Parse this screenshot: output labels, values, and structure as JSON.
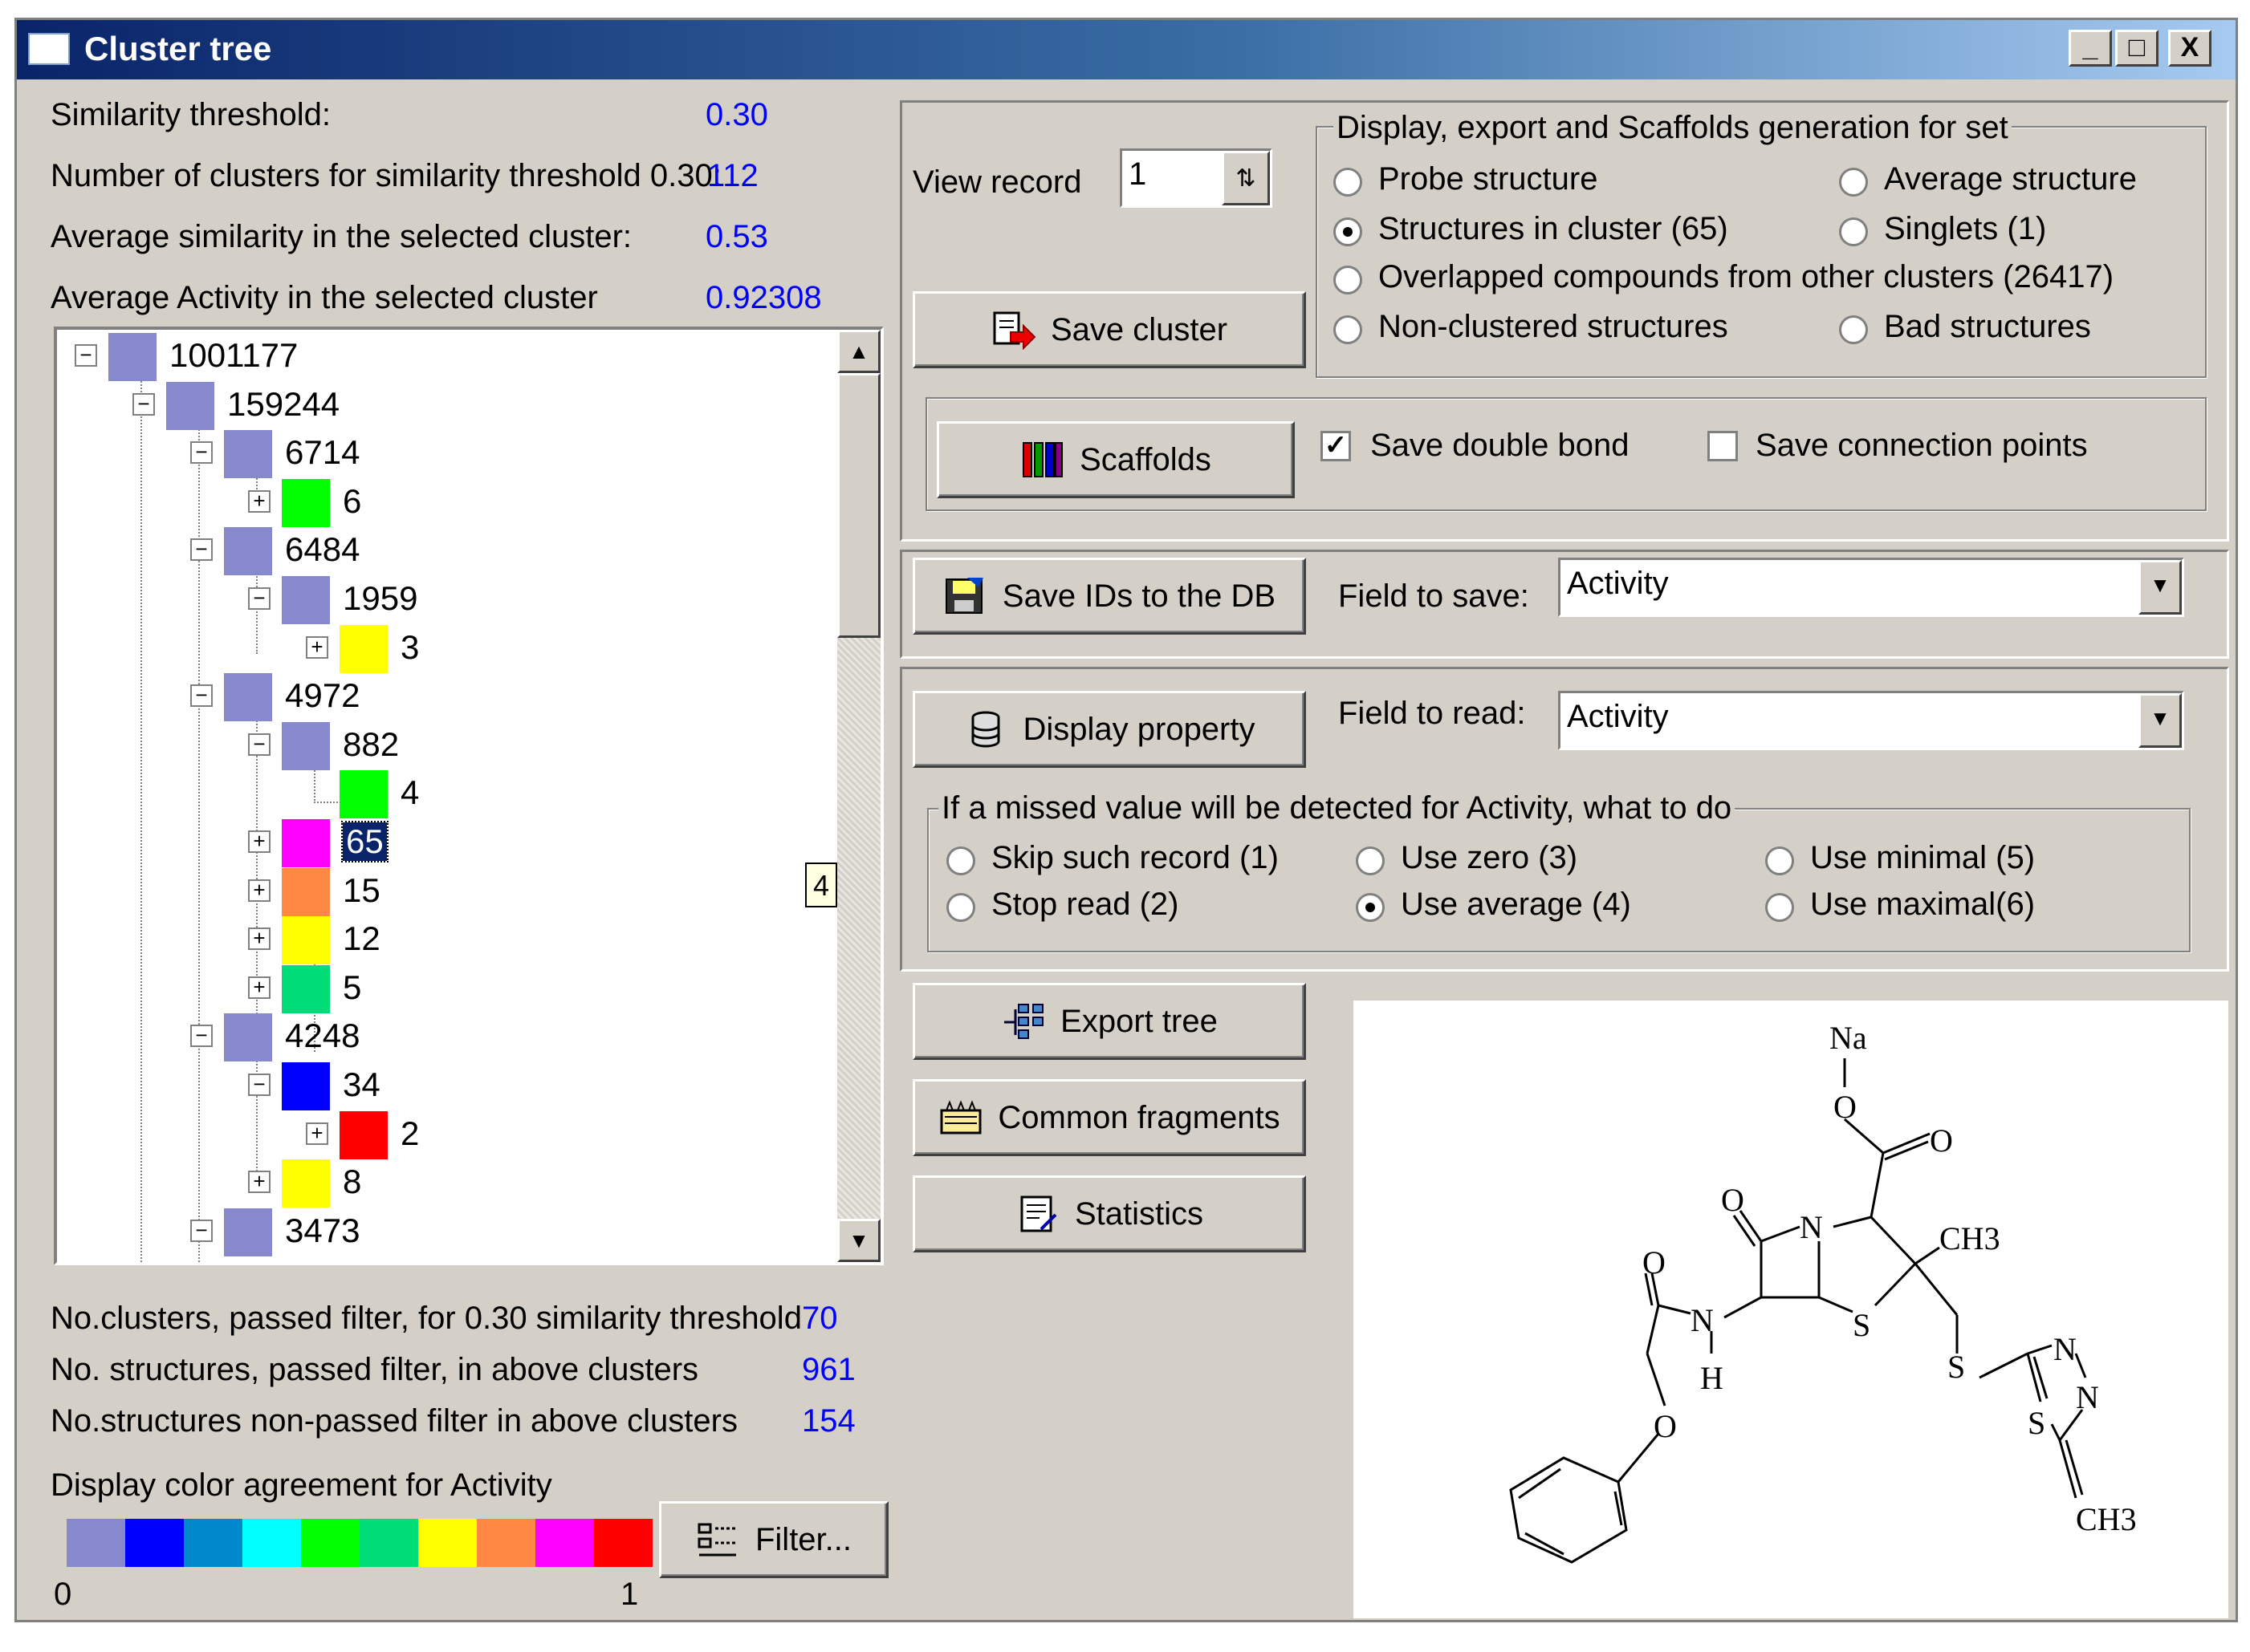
{
  "window": {
    "title": "Cluster tree",
    "controls": [
      "_",
      "□",
      "X"
    ]
  },
  "stats_top": {
    "similarity_threshold_label": "Similarity threshold:",
    "similarity_threshold_value": "0.30",
    "num_clusters_label": "Number of clusters for similarity threshold 0.30:",
    "num_clusters_value": "112",
    "avg_similarity_label": "Average similarity in the selected cluster:",
    "avg_similarity_value": "0.53",
    "avg_activity_label": "Average Activity in the selected cluster",
    "avg_activity_value": "0.92308"
  },
  "tree": {
    "nodes": [
      {
        "label": "1001177",
        "expander": "−",
        "color": "#8888cc"
      },
      {
        "label": "159244",
        "expander": "−",
        "color": "#8888cc"
      },
      {
        "label": "6714",
        "expander": "−",
        "color": "#8888cc"
      },
      {
        "label": "6",
        "expander": "+",
        "color": "#00ff00"
      },
      {
        "label": "6484",
        "expander": "−",
        "color": "#8888cc"
      },
      {
        "label": "1959",
        "expander": "−",
        "color": "#8888cc"
      },
      {
        "label": "3",
        "expander": "+",
        "color": "#ffff00"
      },
      {
        "label": "4972",
        "expander": "−",
        "color": "#8888cc"
      },
      {
        "label": "882",
        "expander": "−",
        "color": "#8888cc"
      },
      {
        "label": "4",
        "expander": "",
        "color": "#00ff00"
      },
      {
        "label": "65",
        "expander": "+",
        "color": "#ff00ff",
        "selected": true
      },
      {
        "label": "15",
        "expander": "+",
        "color": "#ff8844"
      },
      {
        "label": "12",
        "expander": "+",
        "color": "#ffff00"
      },
      {
        "label": "5",
        "expander": "+",
        "color": "#00dd77"
      },
      {
        "label": "4248",
        "expander": "−",
        "color": "#8888cc"
      },
      {
        "label": "34",
        "expander": "−",
        "color": "#0000ff"
      },
      {
        "label": "2",
        "expander": "+",
        "color": "#ff0000"
      },
      {
        "label": "8",
        "expander": "+",
        "color": "#ffff00"
      },
      {
        "label": "3473",
        "expander": "−",
        "color": "#8888cc"
      }
    ],
    "scroll_tooltip": "4"
  },
  "stats_bottom": {
    "clusters_passed_label": "No.clusters, passed filter, for 0.30 similarity threshold",
    "clusters_passed_value": "70",
    "structures_passed_label": "No. structures, passed filter, in above clusters",
    "structures_passed_value": "961",
    "structures_nonpassed_label": "No.structures non-passed filter in above clusters",
    "structures_nonpassed_value": "154"
  },
  "color_agreement": {
    "label": "Display color agreement for Activity",
    "colors": [
      "#8888cc",
      "#0000ff",
      "#0088cc",
      "#00ffff",
      "#00ff00",
      "#00dd77",
      "#ffff00",
      "#ff8844",
      "#ff00ff",
      "#ff0000"
    ],
    "min_label": "0",
    "max_label": "1"
  },
  "filter_button": "Filter...",
  "view_record": {
    "label": "View record",
    "value": "1"
  },
  "save_cluster_button": "Save cluster",
  "display_set": {
    "legend": "Display, export and Scaffolds generation for set",
    "options": [
      {
        "label": "Probe structure",
        "checked": false
      },
      {
        "label": "Average structure",
        "checked": false
      },
      {
        "label": "Structures in cluster (65)",
        "checked": true
      },
      {
        "label": "Singlets (1)",
        "checked": false
      },
      {
        "label": "Overlapped compounds from other clusters (26417)",
        "checked": false
      },
      {
        "label": "Non-clustered structures",
        "checked": false
      },
      {
        "label": "Bad structures",
        "checked": false
      }
    ]
  },
  "scaffolds": {
    "button": "Scaffolds",
    "save_double_bond": "Save double bond",
    "save_double_bond_checked": true,
    "save_connection_points": "Save connection points",
    "save_connection_points_checked": false
  },
  "save_ids": {
    "button": "Save IDs to the DB",
    "field_label": "Field to save:",
    "field_value": "Activity"
  },
  "display_property": {
    "button": "Display property",
    "field_label": "Field to read:",
    "field_value": "Activity"
  },
  "missed_value": {
    "legend": "If a missed value will be detected for Activity, what to do",
    "options": [
      {
        "label": "Skip such record (1)",
        "checked": false
      },
      {
        "label": "Use zero (3)",
        "checked": false
      },
      {
        "label": "Use minimal (5)",
        "checked": false
      },
      {
        "label": "Stop read (2)",
        "checked": false
      },
      {
        "label": "Use average (4)",
        "checked": true
      },
      {
        "label": "Use maximal(6)",
        "checked": false
      }
    ]
  },
  "export_tree_button": "Export tree",
  "common_fragments_button": "Common fragments",
  "statistics_button": "Statistics",
  "molecule": {
    "atoms": [
      "Na",
      "O",
      "O",
      "O",
      "N",
      "CH3",
      "O",
      "N",
      "H",
      "S",
      "S",
      "N",
      "N",
      "S",
      "CH3",
      "O"
    ]
  }
}
